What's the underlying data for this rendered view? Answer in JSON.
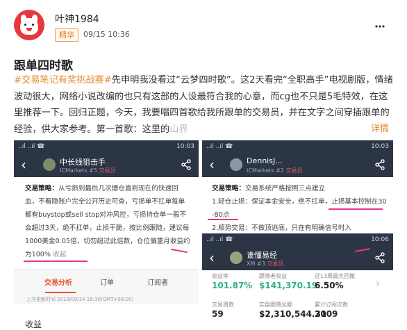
{
  "post": {
    "username": "叶神1984",
    "badge": "精华",
    "date": "09/15 10:36",
    "title": "跟单四时歌",
    "body_tag": "#交易笔记有奖挑战赛#",
    "body_text": "先申明我没看过“云梦四时歌”。这2天看完“全职高手”电视剧版，情绪波动很大，网络小说改编的也只有这部的人设最符合我的心意，而cg也不只是5毛特效，在这里推荐一下。回归正题，今天，我要唱四首歌给我所跟单的交易员，并在文字之间穿插跟单的经验，供大家参考。第一首歌：这里的",
    "body_fade": "山界",
    "more_link": "详情"
  },
  "shot_left": {
    "status_left": "..ıl ..ıl ☎",
    "status_right": "10:03",
    "name": "中长线狙击手",
    "broker": "ICMarkets",
    "rank": "#5",
    "tag": "交易员",
    "strategy_label": "交易策略：",
    "strategy_text": "从亏损到最后几次爆仓直到现在的快速回血，不看隐账户完全公开历史可查，亏损单不扛单每单都有buystop或sell stop对冲风控，亏损持仓单一般不会超过3天，绝不扛单，止损干脆，按比例跟随，建议每1000美金0.05倍，切勿超过此倍数，仓位偏重月收益约为100%",
    "strategy_more": "收起",
    "tabs": [
      "交易分析",
      "订单",
      "订阅者"
    ],
    "updated": "上次更新时间 2019/09/14 16:30(GMT+08:00)",
    "section": "收益"
  },
  "shot_right_top": {
    "status_left": "..ıl ..ıl ☎",
    "status_right": "10:03",
    "name": "DennisJ...",
    "broker": "ICMarkets",
    "rank": "#2",
    "tag": "交易员",
    "strategy_label": "交易策略：",
    "strategy_text": "交易系统严格按照三点建立",
    "line1": "1.轻仓止损：保证本金安全，绝不扛单，止损基本控制在30-80点",
    "line2": "2.顺势交易：不做顶逃底，只在有明确信号时入"
  },
  "shot_right_bottom": {
    "status_left": "..ıl ..ıl ☎",
    "status_right": "10:06",
    "name": "谁懂易经",
    "broker": "XM",
    "rank": "#3",
    "tag": "交易员",
    "stats": [
      {
        "label": "收益率",
        "value": "101.87%",
        "color": "#2bb08a"
      },
      {
        "label": "跟随者收益",
        "value": "$141,370.19",
        "color": "#2bb08a"
      },
      {
        "label": "近13周最大回撤",
        "value": "6.50%",
        "color": "#222222"
      },
      {
        "label": "交易周数",
        "value": "59",
        "color": "#222222"
      },
      {
        "label": "实盘跟随总额",
        "value": "$2,310,544.31",
        "color": "#222222"
      },
      {
        "label": "累计订阅次数",
        "value": "2009",
        "color": "#222222"
      }
    ]
  },
  "colors": {
    "accent": "#e68a2e",
    "nav": "#2c3544",
    "highlight": "#e9348a"
  }
}
